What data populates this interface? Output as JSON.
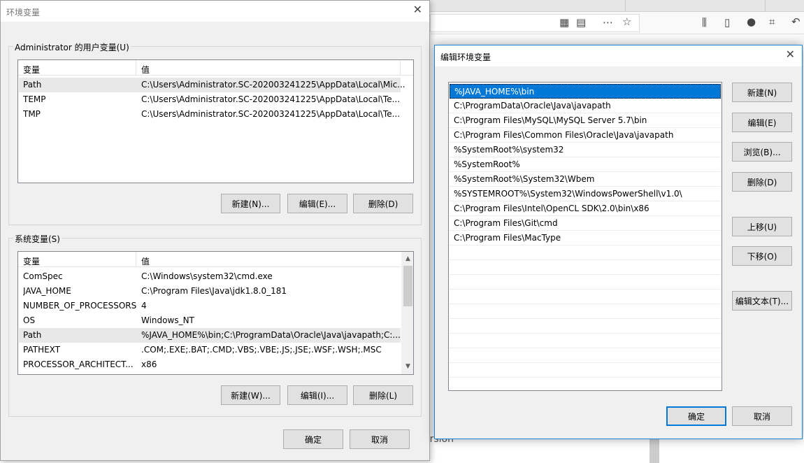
{
  "env_window": {
    "title": "环境变量",
    "user_group_label": "Administrator 的用户变量(U)",
    "col_variable": "变量",
    "col_value": "值",
    "user_vars": [
      {
        "name": "Path",
        "value": "C:\\Users\\Administrator.SC-202003241225\\AppData\\Local\\Mic..."
      },
      {
        "name": "TEMP",
        "value": "C:\\Users\\Administrator.SC-202003241225\\AppData\\Local\\Te..."
      },
      {
        "name": "TMP",
        "value": "C:\\Users\\Administrator.SC-202003241225\\AppData\\Local\\Te..."
      }
    ],
    "user_buttons": {
      "new": "新建(N)...",
      "edit": "编辑(E)...",
      "delete": "删除(D)"
    },
    "system_group_label": "系统变量(S)",
    "system_vars": [
      {
        "name": "ComSpec",
        "value": "C:\\Windows\\system32\\cmd.exe"
      },
      {
        "name": "JAVA_HOME",
        "value": "C:\\Program Files\\Java\\jdk1.8.0_181"
      },
      {
        "name": "NUMBER_OF_PROCESSORS",
        "value": "4"
      },
      {
        "name": "OS",
        "value": "Windows_NT"
      },
      {
        "name": "Path",
        "value": "%JAVA_HOME%\\bin;C:\\ProgramData\\Oracle\\Java\\javapath;C:..."
      },
      {
        "name": "PATHEXT",
        "value": ".COM;.EXE;.BAT;.CMD;.VBS;.VBE;.JS;.JSE;.WSF;.WSH;.MSC"
      },
      {
        "name": "PROCESSOR_ARCHITECT...",
        "value": "x86"
      }
    ],
    "system_buttons": {
      "new": "新建(W)...",
      "edit": "编辑(I)...",
      "delete": "删除(L)"
    },
    "ok": "确定",
    "cancel": "取消"
  },
  "edit_window": {
    "title": "编辑环境变量",
    "paths": [
      "%JAVA_HOME%\\bin",
      "C:\\ProgramData\\Oracle\\Java\\javapath",
      "C:\\Program Files\\MySQL\\MySQL Server 5.7\\bin",
      "C:\\Program Files\\Common Files\\Oracle\\Java\\javapath",
      "%SystemRoot%\\system32",
      "%SystemRoot%",
      "%SystemRoot%\\System32\\Wbem",
      "%SYSTEMROOT%\\System32\\WindowsPowerShell\\v1.0\\",
      "C:\\Program Files\\Intel\\OpenCL SDK\\2.0\\bin\\x86",
      "C:\\Program Files\\Git\\cmd",
      "C:\\Program Files\\MacType"
    ],
    "buttons": {
      "new": "新建(N)",
      "edit": "编辑(E)",
      "browse": "浏览(B)...",
      "delete": "删除(D)",
      "move_up": "上移(U)",
      "move_down": "下移(O)",
      "edit_text": "编辑文本(T)..."
    },
    "ok": "确定",
    "cancel": "取消"
  },
  "background": {
    "bottom_fragment": "ersion"
  }
}
